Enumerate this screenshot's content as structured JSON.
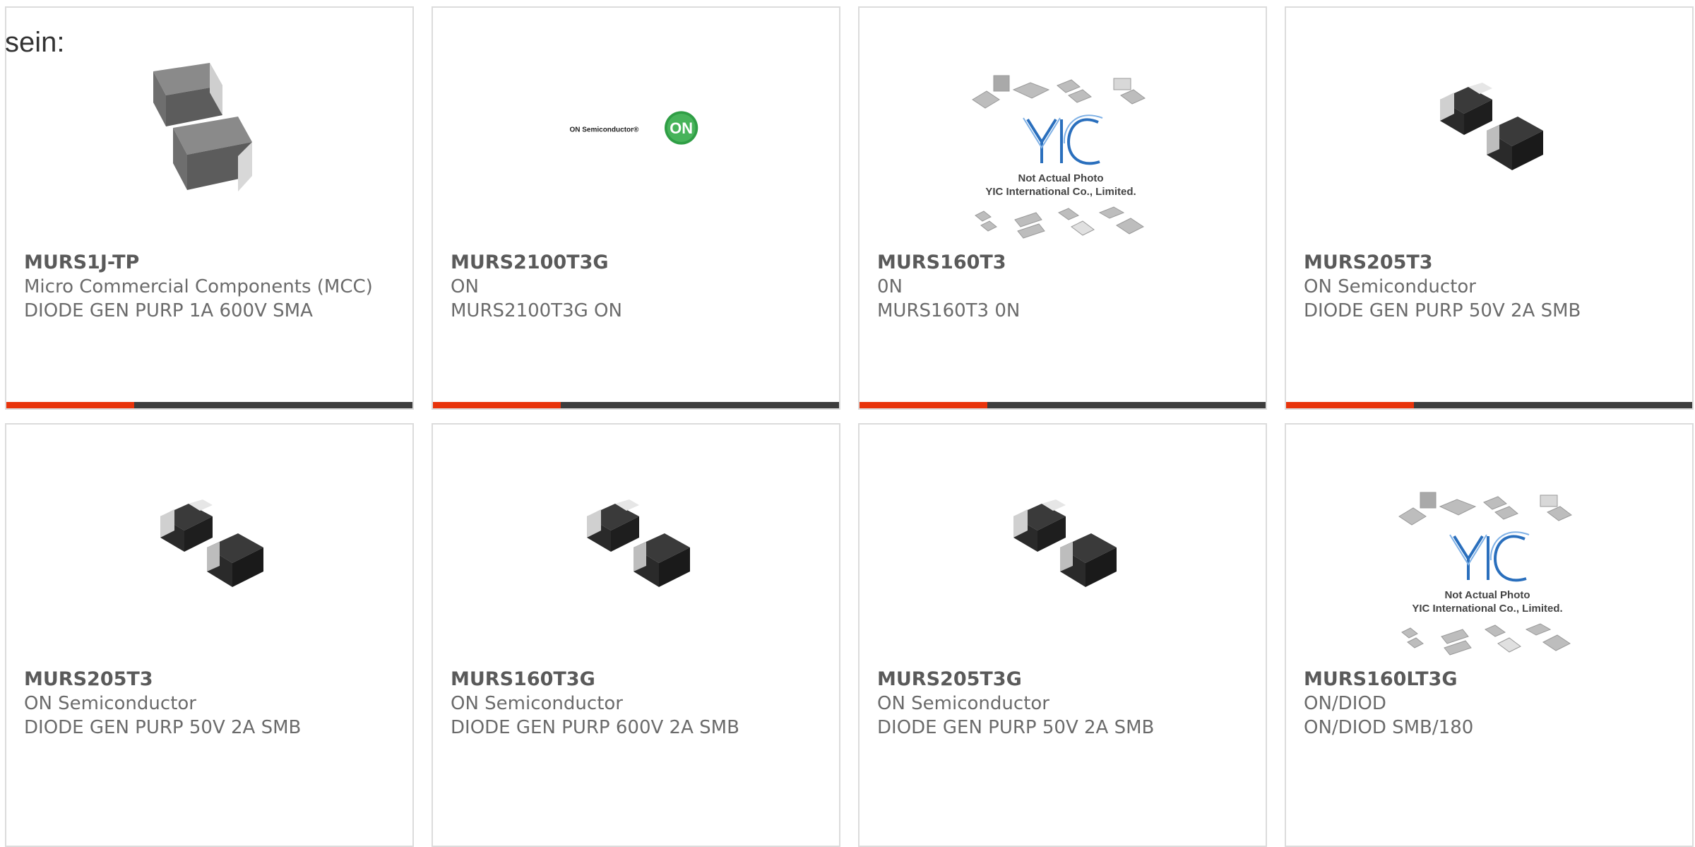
{
  "heading": "sein:",
  "colors": {
    "accent": "#e8340c",
    "bar": "#3d3d3d",
    "card_border": "#dcdcdc",
    "text": "#6b6b6b"
  },
  "products": [
    {
      "part_number": "MURS1J-TP",
      "manufacturer": "Micro Commercial Components (MCC)",
      "description": "DIODE GEN PURP 1A 600V SMA",
      "image": "sma-diode-package",
      "accent_bar": true
    },
    {
      "part_number": "MURS2100T3G",
      "manufacturer": "ON",
      "description": "MURS2100T3G ON",
      "image": "on-semiconductor-logo",
      "logo_text": "ON Semiconductor®",
      "logo_badge": "ON",
      "accent_bar": true
    },
    {
      "part_number": "MURS160T3",
      "manufacturer": "0N",
      "description": "MURS160T3 0N",
      "image": "yic-placeholder",
      "placeholder_line1": "Not Actual Photo",
      "placeholder_line2": "YIC International Co., Limited.",
      "accent_bar": true
    },
    {
      "part_number": "MURS205T3",
      "manufacturer": "ON Semiconductor",
      "description": "DIODE GEN PURP 50V 2A SMB",
      "image": "smb-diode-package",
      "accent_bar": true
    },
    {
      "part_number": "MURS205T3",
      "manufacturer": "ON Semiconductor",
      "description": "DIODE GEN PURP 50V 2A SMB",
      "image": "smb-diode-package"
    },
    {
      "part_number": "MURS160T3G",
      "manufacturer": "ON Semiconductor",
      "description": "DIODE GEN PURP 600V 2A SMB",
      "image": "smb-diode-package"
    },
    {
      "part_number": "MURS205T3G",
      "manufacturer": "ON Semiconductor",
      "description": "DIODE GEN PURP 50V 2A SMB",
      "image": "smb-diode-package"
    },
    {
      "part_number": "MURS160LT3G",
      "manufacturer": "ON/DIOD",
      "description": "ON/DIOD SMB/180",
      "image": "yic-placeholder",
      "placeholder_line1": "Not Actual Photo",
      "placeholder_line2": "YIC International Co., Limited."
    }
  ]
}
